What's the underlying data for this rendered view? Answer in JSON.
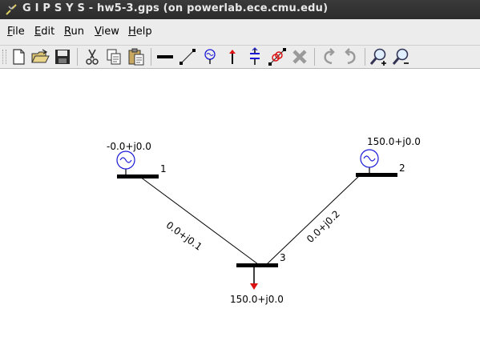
{
  "window": {
    "title": "G I P S Y S - hw5-3.gps (on powerlab.ece.cmu.edu)"
  },
  "menu": [
    "File",
    "Edit",
    "Run",
    "View",
    "Help"
  ],
  "toolbar": {
    "buttons": [
      "new-file-icon",
      "open-folder-icon",
      "save-icon",
      "cut-icon",
      "copy-icon",
      "paste-icon",
      "bus-tool-icon",
      "line-tool-icon",
      "generator-tool-icon",
      "load-tool-icon",
      "capacitor-tool-icon",
      "transformer-tool-icon",
      "delete-icon",
      "undo-icon",
      "redo-icon",
      "zoom-in-icon",
      "zoom-out-icon"
    ]
  },
  "diagram": {
    "buses": [
      {
        "id": "1",
        "label": "1"
      },
      {
        "id": "2",
        "label": "2"
      },
      {
        "id": "3",
        "label": "3"
      }
    ],
    "generators": [
      {
        "bus": "1",
        "value": "-0.0+j0.0"
      },
      {
        "bus": "2",
        "value": "150.0+j0.0"
      }
    ],
    "loads": [
      {
        "bus": "3",
        "value": "150.0+j0.0"
      }
    ],
    "lines": [
      {
        "from": "1",
        "to": "3",
        "impedance": "0.0+j0.1"
      },
      {
        "from": "2",
        "to": "3",
        "impedance": "0.0+j0.2"
      }
    ]
  },
  "colors": {
    "titlebar": "#2b2b2b",
    "menubar": "#ececec",
    "generator": "#1a1ad6",
    "load": "#dd1111",
    "bus": "#000000"
  }
}
